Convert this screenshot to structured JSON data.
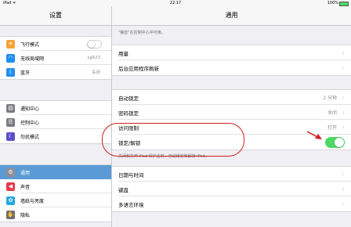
{
  "status_bar": {
    "carrier": "iPad ᯤ",
    "time": "22:17",
    "battery": "100%"
  },
  "sidebar": {
    "title": "设置",
    "groups": [
      [
        {
          "label": "飞行模式",
          "icon": "airplane-icon",
          "color": "#f7a233",
          "glyph": "✈",
          "toggle": "off"
        },
        {
          "label": "无线局域网",
          "icon": "wifi-icon",
          "color": "#1f8ef1",
          "glyph": "◠",
          "value": "xjj623"
        },
        {
          "label": "蓝牙",
          "icon": "bluetooth-icon",
          "color": "#1f8ef1",
          "glyph": "ᛒ",
          "value": "关闭"
        }
      ],
      [
        {
          "label": "通知中心",
          "icon": "notification-center-icon",
          "color": "#7b7b80",
          "glyph": "▤"
        },
        {
          "label": "控制中心",
          "icon": "control-center-icon",
          "color": "#7b7b80",
          "glyph": "☰"
        },
        {
          "label": "勿扰模式",
          "icon": "do-not-disturb-icon",
          "color": "#5b4fc9",
          "glyph": "☾"
        }
      ],
      [
        {
          "label": "通用",
          "icon": "gear-icon",
          "color": "#8e8e93",
          "glyph": "⚙",
          "selected": true
        },
        {
          "label": "声音",
          "icon": "sound-icon",
          "color": "#e8394d",
          "glyph": "◀"
        },
        {
          "label": "墙纸与亮度",
          "icon": "wallpaper-icon",
          "color": "#24a9e0",
          "glyph": "✿"
        },
        {
          "label": "隐私",
          "icon": "privacy-icon",
          "color": "#6d6d72",
          "glyph": "✋"
        }
      ]
    ]
  },
  "main": {
    "title": "通用",
    "top_note": "\"静音\"在控制中心中可用。",
    "groups": [
      [
        {
          "label": "用量"
        },
        {
          "label": "后台应用程序刷新"
        }
      ],
      [
        {
          "label": "自动锁定",
          "value": "2 分钟"
        },
        {
          "label": "密码锁定",
          "value": "关闭"
        },
        {
          "label": "访问限制",
          "value": "打开"
        },
        {
          "label": "锁定/解锁",
          "toggle": "on"
        }
      ],
      [
        {
          "label": "日期与时间"
        },
        {
          "label": "键盘"
        },
        {
          "label": "多语言环境"
        }
      ]
    ],
    "lock_note": "关闭和打开 iPad 保护盖时，自动锁定和解锁 iPad。"
  },
  "colors": {
    "toggle_on": "#4cd964",
    "selection": "#5b9bd5",
    "annotation": "#d0211c"
  }
}
